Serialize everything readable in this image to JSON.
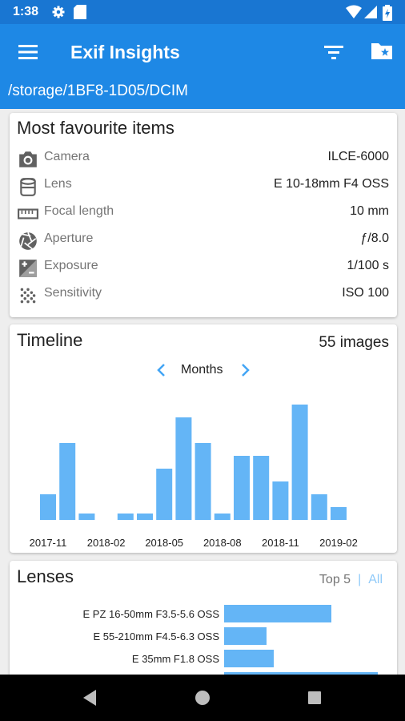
{
  "status_bar": {
    "time": "1:38",
    "icons": [
      "gear-icon",
      "sd-card-icon",
      "wifi-icon",
      "signal-icon",
      "battery-icon"
    ]
  },
  "app_bar": {
    "title": "Exif Insights",
    "menu_icon": "hamburger-menu-icon",
    "actions": [
      "filter-icon",
      "folder-star-icon"
    ],
    "color": "#1e88e5"
  },
  "path": "/storage/1BF8-1D05/DCIM",
  "favourites": {
    "title": "Most favourite items",
    "rows": [
      {
        "icon": "camera-icon",
        "label": "Camera",
        "value": "ILCE-6000"
      },
      {
        "icon": "lens-icon",
        "label": "Lens",
        "value": "E 10-18mm F4 OSS"
      },
      {
        "icon": "ruler-icon",
        "label": "Focal length",
        "value": "10 mm"
      },
      {
        "icon": "aperture-icon",
        "label": "Aperture",
        "value": "ƒ/8.0"
      },
      {
        "icon": "exposure-icon",
        "label": "Exposure",
        "value": "1/100 s"
      },
      {
        "icon": "grain-icon",
        "label": "Sensitivity",
        "value": "ISO 100"
      }
    ]
  },
  "timeline": {
    "title": "Timeline",
    "count": "55 images",
    "period": "Months",
    "prev_icon": "chevron-left-icon",
    "next_icon": "chevron-right-icon"
  },
  "chart_data": {
    "type": "bar",
    "categories": [
      "2017-11",
      "2017-12",
      "2018-01",
      "2018-02",
      "2018-03",
      "2018-04",
      "2018-05",
      "2018-06",
      "2018-07",
      "2018-08",
      "2018-09",
      "2018-10",
      "2018-11",
      "2018-12",
      "2019-01",
      "2019-02",
      "2019-03"
    ],
    "values": [
      4,
      12,
      1,
      0,
      1,
      1,
      8,
      16,
      12,
      1,
      10,
      10,
      6,
      18,
      4,
      2,
      0
    ],
    "tick_labels": [
      "2017-11",
      "2018-02",
      "2018-05",
      "2018-08",
      "2018-11",
      "2019-02"
    ],
    "bar_color": "#64b5f6",
    "grid": false
  },
  "lenses": {
    "title": "Lenses",
    "top_label": "Top 5",
    "separator": "|",
    "all_label": "All",
    "items": [
      {
        "name": "E PZ 16-50mm F3.5-5.6 OSS",
        "share": 0.28
      },
      {
        "name": "E 55-210mm F4.5-6.3 OSS",
        "share": 0.11
      },
      {
        "name": "E 35mm F1.8 OSS",
        "share": 0.13
      },
      {
        "name": "",
        "share": 0.4
      }
    ]
  }
}
